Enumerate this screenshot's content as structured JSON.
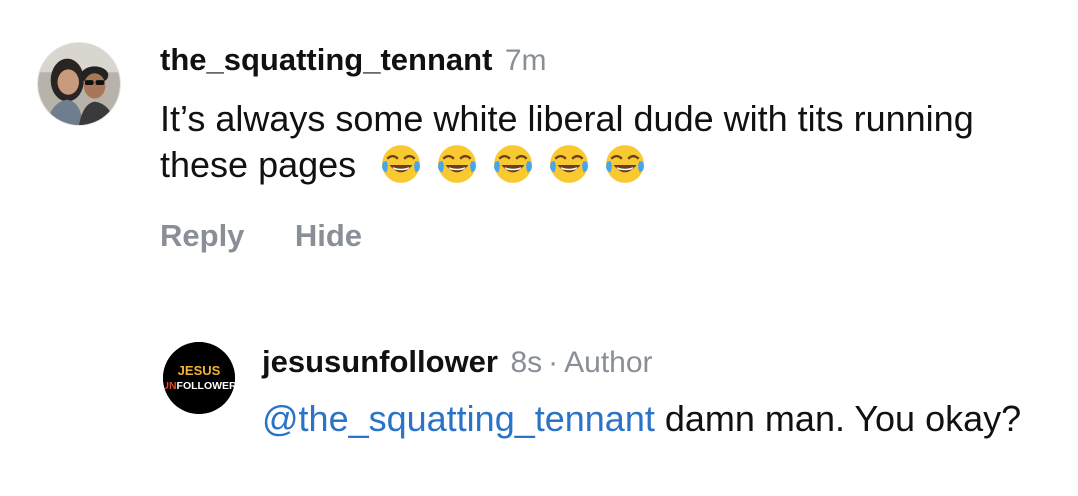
{
  "comment": {
    "username": "the_squatting_tennant",
    "time": "7m",
    "text": "It’s always some white liberal dude with tits running these pages",
    "emojis": [
      "face-with-tears-of-joy-icon",
      "face-with-tears-of-joy-icon",
      "face-with-tears-of-joy-icon",
      "face-with-tears-of-joy-icon",
      "face-with-tears-of-joy-icon"
    ],
    "actions": {
      "reply": "Reply",
      "hide": "Hide"
    }
  },
  "reply": {
    "username": "jesusunfollower",
    "time": "8s",
    "separator": "·",
    "role": "Author",
    "mention": "@the_squatting_tennant",
    "text": "damn man. You okay?",
    "avatar_text": {
      "line1": "JESUS",
      "line2": "UNFOLLOWER"
    }
  },
  "colors": {
    "text": "#111111",
    "muted": "#8a8f97",
    "mention": "#2a73c9",
    "avatar_bg": "#000000",
    "avatar_accent": "#f2b233"
  }
}
